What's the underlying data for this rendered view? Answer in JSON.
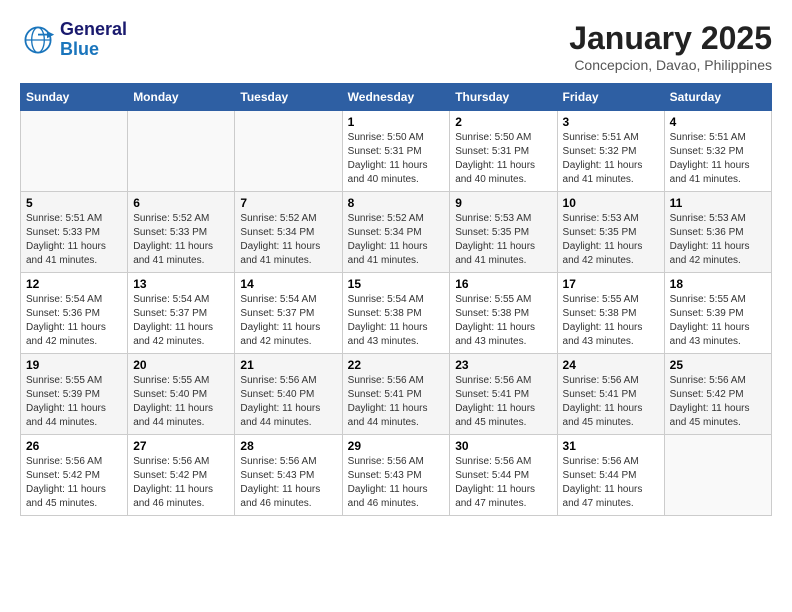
{
  "header": {
    "logo_line1": "General",
    "logo_line2": "Blue",
    "month_title": "January 2025",
    "location": "Concepcion, Davao, Philippines"
  },
  "days_of_week": [
    "Sunday",
    "Monday",
    "Tuesday",
    "Wednesday",
    "Thursday",
    "Friday",
    "Saturday"
  ],
  "weeks": [
    [
      {
        "day": "",
        "info": ""
      },
      {
        "day": "",
        "info": ""
      },
      {
        "day": "",
        "info": ""
      },
      {
        "day": "1",
        "info": "Sunrise: 5:50 AM\nSunset: 5:31 PM\nDaylight: 11 hours\nand 40 minutes."
      },
      {
        "day": "2",
        "info": "Sunrise: 5:50 AM\nSunset: 5:31 PM\nDaylight: 11 hours\nand 40 minutes."
      },
      {
        "day": "3",
        "info": "Sunrise: 5:51 AM\nSunset: 5:32 PM\nDaylight: 11 hours\nand 41 minutes."
      },
      {
        "day": "4",
        "info": "Sunrise: 5:51 AM\nSunset: 5:32 PM\nDaylight: 11 hours\nand 41 minutes."
      }
    ],
    [
      {
        "day": "5",
        "info": "Sunrise: 5:51 AM\nSunset: 5:33 PM\nDaylight: 11 hours\nand 41 minutes."
      },
      {
        "day": "6",
        "info": "Sunrise: 5:52 AM\nSunset: 5:33 PM\nDaylight: 11 hours\nand 41 minutes."
      },
      {
        "day": "7",
        "info": "Sunrise: 5:52 AM\nSunset: 5:34 PM\nDaylight: 11 hours\nand 41 minutes."
      },
      {
        "day": "8",
        "info": "Sunrise: 5:52 AM\nSunset: 5:34 PM\nDaylight: 11 hours\nand 41 minutes."
      },
      {
        "day": "9",
        "info": "Sunrise: 5:53 AM\nSunset: 5:35 PM\nDaylight: 11 hours\nand 41 minutes."
      },
      {
        "day": "10",
        "info": "Sunrise: 5:53 AM\nSunset: 5:35 PM\nDaylight: 11 hours\nand 42 minutes."
      },
      {
        "day": "11",
        "info": "Sunrise: 5:53 AM\nSunset: 5:36 PM\nDaylight: 11 hours\nand 42 minutes."
      }
    ],
    [
      {
        "day": "12",
        "info": "Sunrise: 5:54 AM\nSunset: 5:36 PM\nDaylight: 11 hours\nand 42 minutes."
      },
      {
        "day": "13",
        "info": "Sunrise: 5:54 AM\nSunset: 5:37 PM\nDaylight: 11 hours\nand 42 minutes."
      },
      {
        "day": "14",
        "info": "Sunrise: 5:54 AM\nSunset: 5:37 PM\nDaylight: 11 hours\nand 42 minutes."
      },
      {
        "day": "15",
        "info": "Sunrise: 5:54 AM\nSunset: 5:38 PM\nDaylight: 11 hours\nand 43 minutes."
      },
      {
        "day": "16",
        "info": "Sunrise: 5:55 AM\nSunset: 5:38 PM\nDaylight: 11 hours\nand 43 minutes."
      },
      {
        "day": "17",
        "info": "Sunrise: 5:55 AM\nSunset: 5:38 PM\nDaylight: 11 hours\nand 43 minutes."
      },
      {
        "day": "18",
        "info": "Sunrise: 5:55 AM\nSunset: 5:39 PM\nDaylight: 11 hours\nand 43 minutes."
      }
    ],
    [
      {
        "day": "19",
        "info": "Sunrise: 5:55 AM\nSunset: 5:39 PM\nDaylight: 11 hours\nand 44 minutes."
      },
      {
        "day": "20",
        "info": "Sunrise: 5:55 AM\nSunset: 5:40 PM\nDaylight: 11 hours\nand 44 minutes."
      },
      {
        "day": "21",
        "info": "Sunrise: 5:56 AM\nSunset: 5:40 PM\nDaylight: 11 hours\nand 44 minutes."
      },
      {
        "day": "22",
        "info": "Sunrise: 5:56 AM\nSunset: 5:41 PM\nDaylight: 11 hours\nand 44 minutes."
      },
      {
        "day": "23",
        "info": "Sunrise: 5:56 AM\nSunset: 5:41 PM\nDaylight: 11 hours\nand 45 minutes."
      },
      {
        "day": "24",
        "info": "Sunrise: 5:56 AM\nSunset: 5:41 PM\nDaylight: 11 hours\nand 45 minutes."
      },
      {
        "day": "25",
        "info": "Sunrise: 5:56 AM\nSunset: 5:42 PM\nDaylight: 11 hours\nand 45 minutes."
      }
    ],
    [
      {
        "day": "26",
        "info": "Sunrise: 5:56 AM\nSunset: 5:42 PM\nDaylight: 11 hours\nand 45 minutes."
      },
      {
        "day": "27",
        "info": "Sunrise: 5:56 AM\nSunset: 5:42 PM\nDaylight: 11 hours\nand 46 minutes."
      },
      {
        "day": "28",
        "info": "Sunrise: 5:56 AM\nSunset: 5:43 PM\nDaylight: 11 hours\nand 46 minutes."
      },
      {
        "day": "29",
        "info": "Sunrise: 5:56 AM\nSunset: 5:43 PM\nDaylight: 11 hours\nand 46 minutes."
      },
      {
        "day": "30",
        "info": "Sunrise: 5:56 AM\nSunset: 5:44 PM\nDaylight: 11 hours\nand 47 minutes."
      },
      {
        "day": "31",
        "info": "Sunrise: 5:56 AM\nSunset: 5:44 PM\nDaylight: 11 hours\nand 47 minutes."
      },
      {
        "day": "",
        "info": ""
      }
    ]
  ]
}
